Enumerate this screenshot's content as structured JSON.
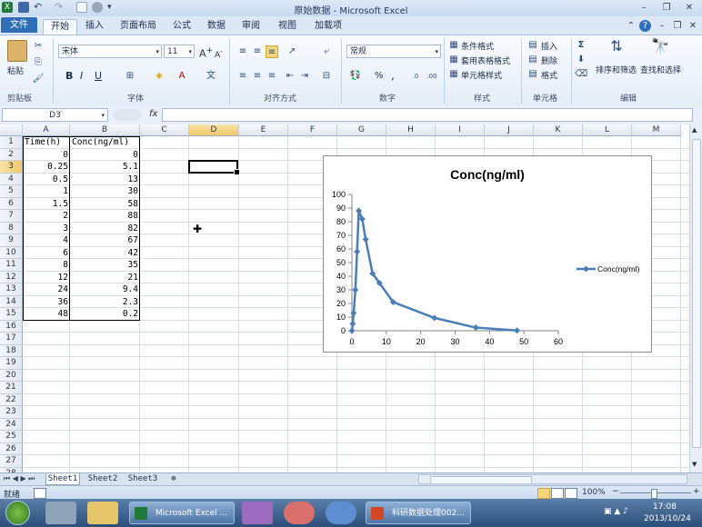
{
  "window": {
    "title": "原始数据 - Microsoft Excel"
  },
  "tabs": [
    "文件",
    "开始",
    "插入",
    "页面布局",
    "公式",
    "数据",
    "审阅",
    "视图",
    "加载项"
  ],
  "ribbon": {
    "paste_label": "粘贴",
    "font_name": "宋体",
    "font_size": "11",
    "number_format": "常规",
    "conditional_format": "条件格式",
    "table_format": "套用表格格式",
    "cell_style": "单元格样式",
    "insert": "插入",
    "delete": "删除",
    "format": "格式",
    "sort_filter": "排序和筛选",
    "find_select": "查找和选择",
    "bold": "B",
    "italic": "I",
    "underline": "U",
    "font_grow": "A",
    "font_shrink": "A",
    "percent": "%",
    "comma": ",",
    "groups": [
      "剪贴板",
      "字体",
      "对齐方式",
      "数字",
      "样式",
      "单元格",
      "编辑"
    ]
  },
  "formula_bar": {
    "name_box": "D3",
    "fx": "fx",
    "formula": ""
  },
  "columns": [
    "A",
    "B",
    "C",
    "D",
    "E",
    "F",
    "G",
    "H",
    "I",
    "J",
    "K",
    "L",
    "M"
  ],
  "selected_column": "D",
  "selected_row": 3,
  "rows": [
    "1",
    "2",
    "3",
    "4",
    "5",
    "6",
    "7",
    "8",
    "9",
    "10",
    "11",
    "12",
    "13",
    "14",
    "15",
    "16",
    "17",
    "18",
    "19",
    "20",
    "21",
    "22",
    "23",
    "24",
    "25",
    "26",
    "27",
    "28"
  ],
  "table": {
    "headers": [
      "Time(h)",
      "Conc(ng/ml)"
    ],
    "time": [
      "0",
      "0.25",
      "0.5",
      "1",
      "1.5",
      "2",
      "3",
      "4",
      "6",
      "8",
      "12",
      "24",
      "36",
      "48"
    ],
    "conc": [
      "0",
      "5.1",
      "13",
      "30",
      "58",
      "88",
      "82",
      "67",
      "42",
      "35",
      "21",
      "9.4",
      "2.3",
      "0.2"
    ]
  },
  "chart_data": {
    "type": "scatter",
    "title": "Conc(ng/ml)",
    "xlabel": "",
    "ylabel": "",
    "xlim": [
      0,
      60
    ],
    "ylim": [
      0,
      100
    ],
    "x_ticks": [
      0,
      10,
      20,
      30,
      40,
      50,
      60
    ],
    "y_ticks": [
      0,
      10,
      20,
      30,
      40,
      50,
      60,
      70,
      80,
      90,
      100
    ],
    "legend": "right",
    "grid": false,
    "series": [
      {
        "name": "Conc(ng/ml)",
        "color": "#4a7ebb",
        "x": [
          0,
          0.25,
          0.5,
          1,
          1.5,
          2,
          3,
          4,
          6,
          8,
          12,
          24,
          36,
          48
        ],
        "y": [
          0,
          5.1,
          13,
          30,
          58,
          88,
          82,
          67,
          42,
          35,
          21,
          9.4,
          2.3,
          0.2
        ]
      }
    ]
  },
  "sheets": [
    "Sheet1",
    "Sheet2",
    "Sheet3"
  ],
  "status": {
    "ready": "就绪",
    "zoom": "100%",
    "zoom_minus": "−",
    "zoom_plus": "+"
  },
  "taskbar": {
    "excel_task": "Microsoft Excel ...",
    "ppt_task": "科研数据处理002...",
    "time": "17:08",
    "date": "2013/10/24"
  },
  "colors": {
    "accent": "#2f6fb7",
    "series": "#4a7ebb",
    "selected_header": "#f2c767"
  }
}
